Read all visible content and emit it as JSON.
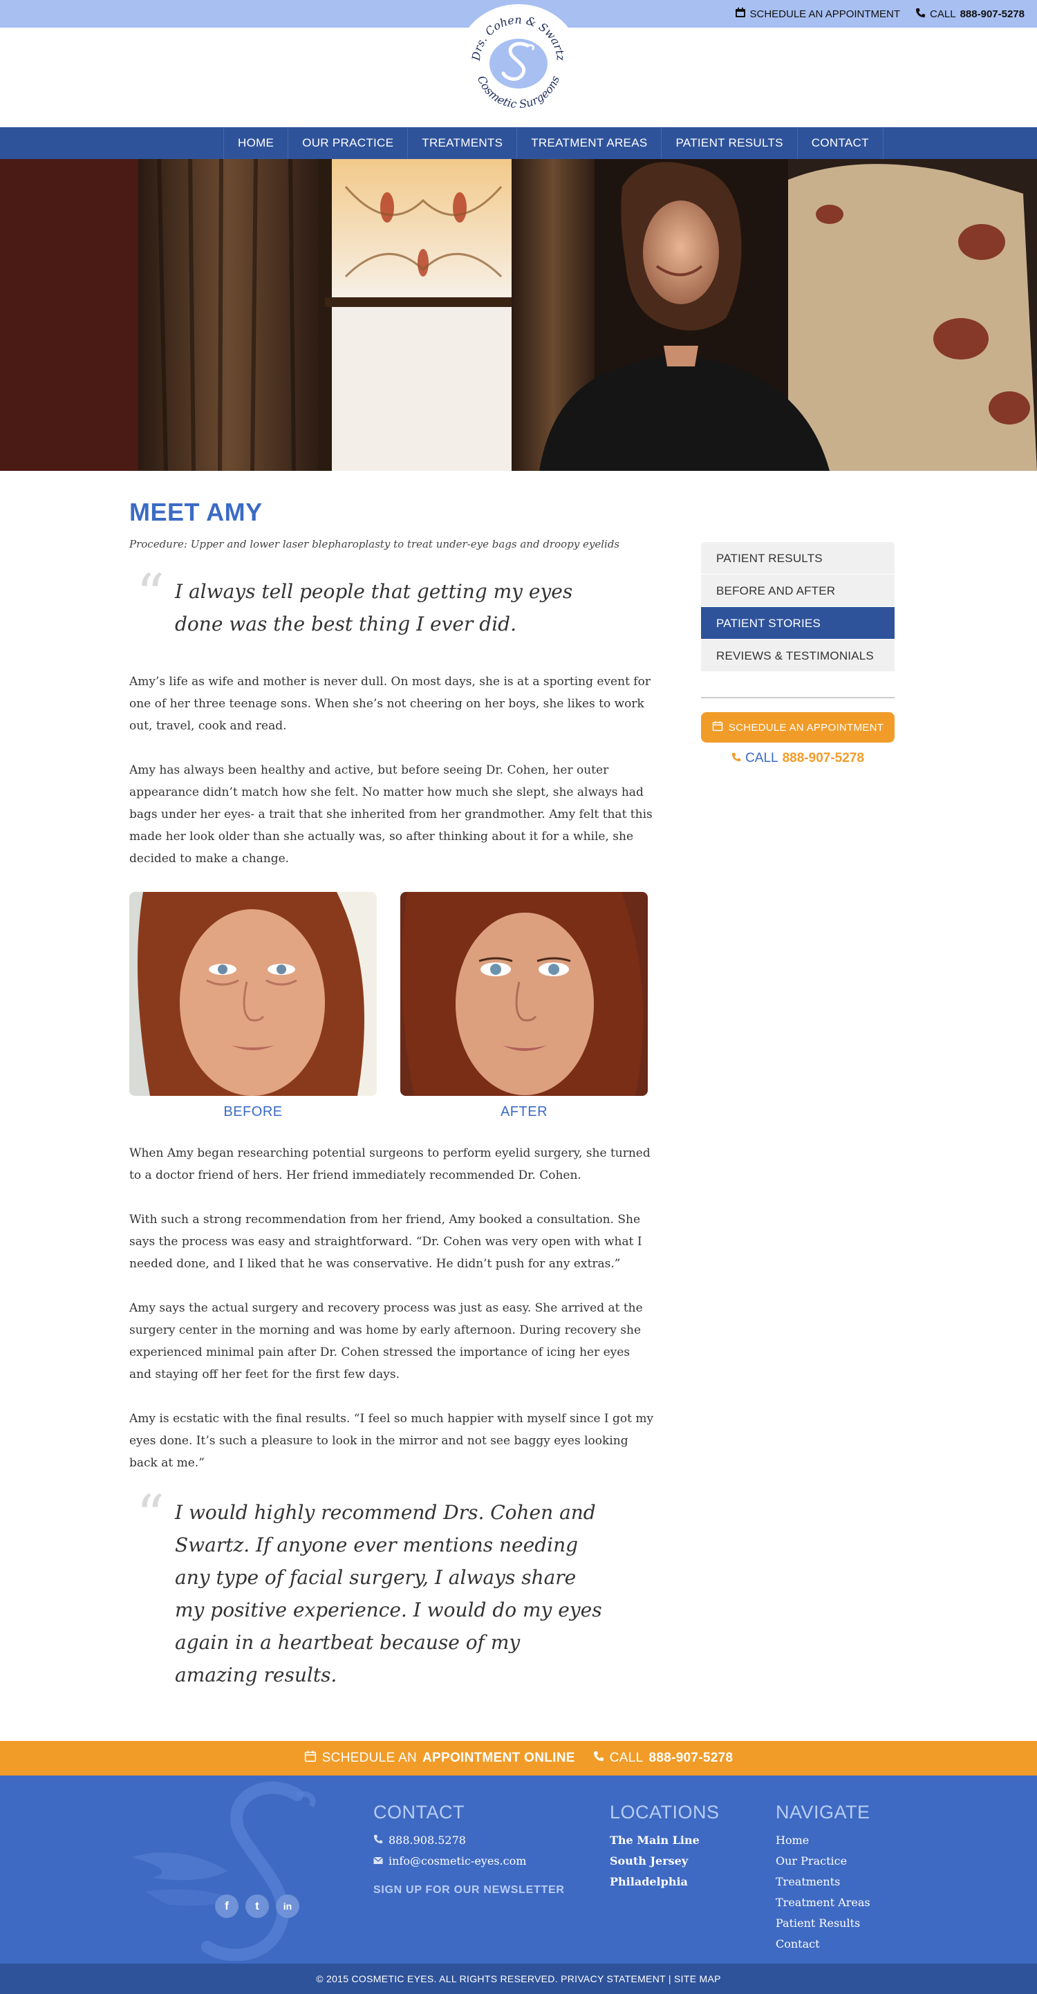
{
  "topbar": {
    "schedule_label": "SCHEDULE AN APPOINTMENT",
    "call_prefix": "CALL",
    "phone": "888-907-5278"
  },
  "logo": {
    "line1": "Drs. Cohen & Swartz",
    "line2": "Cosmetic Surgeons"
  },
  "nav": {
    "items": [
      "HOME",
      "OUR PRACTICE",
      "TREATMENTS",
      "TREATMENT AREAS",
      "PATIENT RESULTS",
      "CONTACT"
    ]
  },
  "main": {
    "title": "MEET AMY",
    "procedure": "Procedure: Upper and lower laser blepharoplasty to treat under-eye bags and droopy eyelids",
    "quote1": "I always tell people that getting my eyes done was the best thing I ever did.",
    "paragraphs_a": [
      "Amy’s life as wife and mother is never dull. On most days, she is at a sporting event for one of her three teenage sons. When she’s not cheering on her boys, she likes to work out, travel, cook and read.",
      "Amy has always been healthy and active, but before seeing Dr. Cohen, her outer appearance didn’t match how she felt. No matter how much she slept, she always had bags under her eyes- a trait that she inherited from her grandmother. Amy felt that this made her look older than she actually was, so after thinking about it for a while, she decided to make a change."
    ],
    "before_label": "BEFORE",
    "after_label": "AFTER",
    "paragraphs_b": [
      "When Amy began researching potential surgeons to perform eyelid surgery, she turned to a doctor friend of hers. Her friend immediately recommended Dr. Cohen.",
      "With such a strong recommendation from her friend, Amy booked a consultation. She says the process was easy and straightforward. “Dr. Cohen was very open with what I needed done, and I liked that he was conservative. He didn’t push for any extras.”",
      "Amy says the actual surgery and recovery process was just as easy. She arrived at the surgery center in the morning and was home by early afternoon. During recovery she experienced minimal pain after Dr. Cohen stressed the importance of icing her eyes and staying off her feet for the first few days.",
      "Amy is ecstatic with the final results. “I feel so much happier with myself since I got my eyes done. It’s such a pleasure to look in the mirror and not see baggy eyes looking back at me.”"
    ],
    "quote2": "I would highly recommend Drs. Cohen and Swartz. If anyone ever mentions needing any type of facial surgery, I always share my positive experience. I would do my eyes again in a heartbeat because of my amazing results."
  },
  "sidebar": {
    "items": [
      "PATIENT RESULTS",
      "BEFORE AND AFTER",
      "PATIENT STORIES",
      "REVIEWS & TESTIMONIALS"
    ],
    "active_index": 2,
    "cta_label": "SCHEDULE AN APPOINTMENT",
    "call_prefix": "CALL",
    "phone": "888-907-5278"
  },
  "cta_bar": {
    "schedule_prefix": "SCHEDULE AN",
    "schedule_bold": "APPOINTMENT ONLINE",
    "call_prefix": "CALL",
    "phone": "888-907-5278"
  },
  "footer": {
    "contact_heading": "CONTACT",
    "contact_phone": "888.908.5278",
    "contact_email": "info@cosmetic-eyes.com",
    "newsletter": "SIGN UP FOR OUR NEWSLETTER",
    "locations_heading": "LOCATIONS",
    "locations": [
      "The Main Line",
      "South Jersey",
      "Philadelphia"
    ],
    "navigate_heading": "NAVIGATE",
    "navigate": [
      "Home",
      "Our Practice",
      "Treatments",
      "Treatment Areas",
      "Patient Results",
      "Contact"
    ],
    "socials": [
      "f",
      "t",
      "in"
    ]
  },
  "copyright": {
    "text": "© 2015 COSMETIC EYES. ALL RIGHTS RESERVED.",
    "privacy": "PRIVACY STATEMENT",
    "separator": "|",
    "sitemap": "SITE MAP"
  },
  "colors": {
    "topbar": "#a7bff1",
    "nav": "#2f539b",
    "accent_blue": "#3b6bc4",
    "accent_orange": "#f19c29",
    "footer": "#3f6ac3"
  }
}
